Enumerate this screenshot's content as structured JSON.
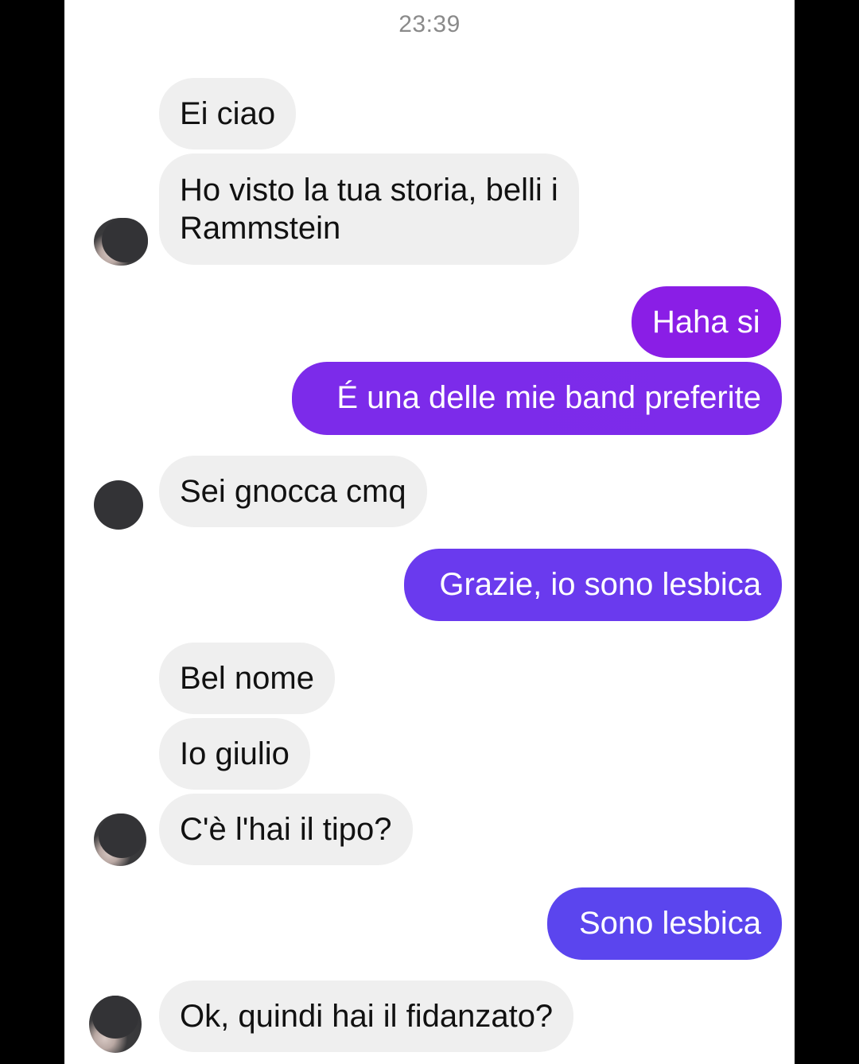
{
  "chat": {
    "timestamp": "23:39",
    "messages": [
      {
        "id": "m1",
        "direction": "incoming",
        "text": "Ei ciao"
      },
      {
        "id": "m2",
        "direction": "incoming",
        "text": "Ho visto la tua storia, belli i\nRammstein"
      },
      {
        "id": "m3",
        "direction": "outgoing",
        "text": "Haha si"
      },
      {
        "id": "m4",
        "direction": "outgoing",
        "text": "É una delle mie band preferite"
      },
      {
        "id": "m5",
        "direction": "incoming",
        "text": "Sei gnocca cmq"
      },
      {
        "id": "m6",
        "direction": "outgoing",
        "text": "Grazie, io sono lesbica"
      },
      {
        "id": "m7",
        "direction": "incoming",
        "text": "Bel nome"
      },
      {
        "id": "m8",
        "direction": "incoming",
        "text": "Io giulio"
      },
      {
        "id": "m9",
        "direction": "incoming",
        "text": "C'è l'hai il tipo?"
      },
      {
        "id": "m10",
        "direction": "outgoing",
        "text": "Sono lesbica"
      },
      {
        "id": "m11",
        "direction": "incoming",
        "text": "Ok, quindi hai il fidanzato?"
      }
    ]
  },
  "colors": {
    "incoming_bubble": "#efefef",
    "outgoing_gradient": [
      "#8a1ee6",
      "#5b45ee"
    ],
    "timestamp_text": "#8a8a8a"
  },
  "icons": {
    "sender_avatar": "avatar-icon"
  }
}
